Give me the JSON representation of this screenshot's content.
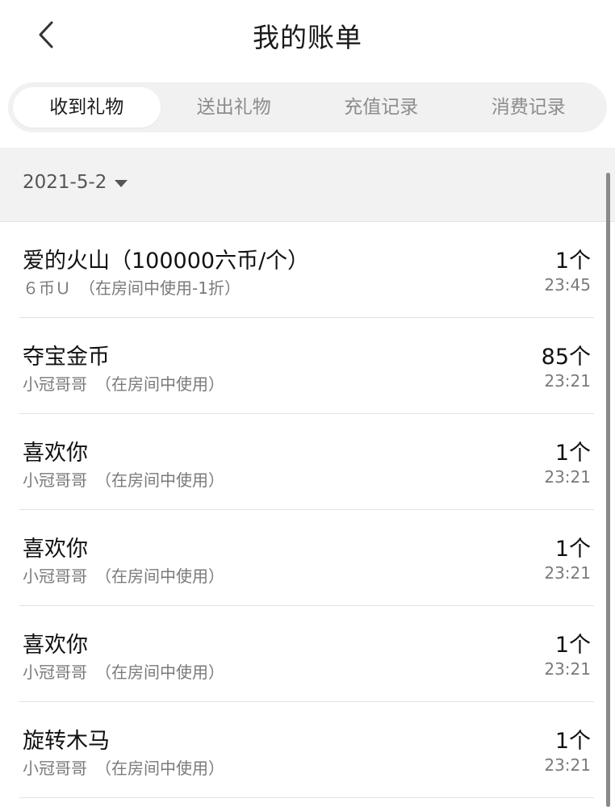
{
  "header": {
    "title": "我的账单",
    "back_icon": "chevron-left-icon"
  },
  "tabs": [
    {
      "label": "收到礼物",
      "active": true
    },
    {
      "label": "送出礼物",
      "active": false
    },
    {
      "label": "充值记录",
      "active": false
    },
    {
      "label": "消费记录",
      "active": false
    }
  ],
  "date_filter": {
    "value": "2021-5-2",
    "icon": "caret-down-icon"
  },
  "records": [
    {
      "name": "爱的火山（100000六币/个）",
      "sub": "６币Ｕ　（在房间中使用-1折）",
      "qty": "1个",
      "time": "23:45"
    },
    {
      "name": "夺宝金币",
      "sub": "小冠哥哥　（在房间中使用）",
      "qty": "85个",
      "time": "23:21"
    },
    {
      "name": "喜欢你",
      "sub": "小冠哥哥　（在房间中使用）",
      "qty": "1个",
      "time": "23:21"
    },
    {
      "name": "喜欢你",
      "sub": "小冠哥哥　（在房间中使用）",
      "qty": "1个",
      "time": "23:21"
    },
    {
      "name": "喜欢你",
      "sub": "小冠哥哥　（在房间中使用）",
      "qty": "1个",
      "time": "23:21"
    },
    {
      "name": "旋转木马",
      "sub": "小冠哥哥　（在房间中使用）",
      "qty": "1个",
      "time": "23:21"
    }
  ],
  "colors": {
    "accent_text": "#1a1a1a",
    "muted_text": "#8c8c8c",
    "tab_bg": "#f1f1f1",
    "date_bar_bg": "#f2f2f2"
  }
}
